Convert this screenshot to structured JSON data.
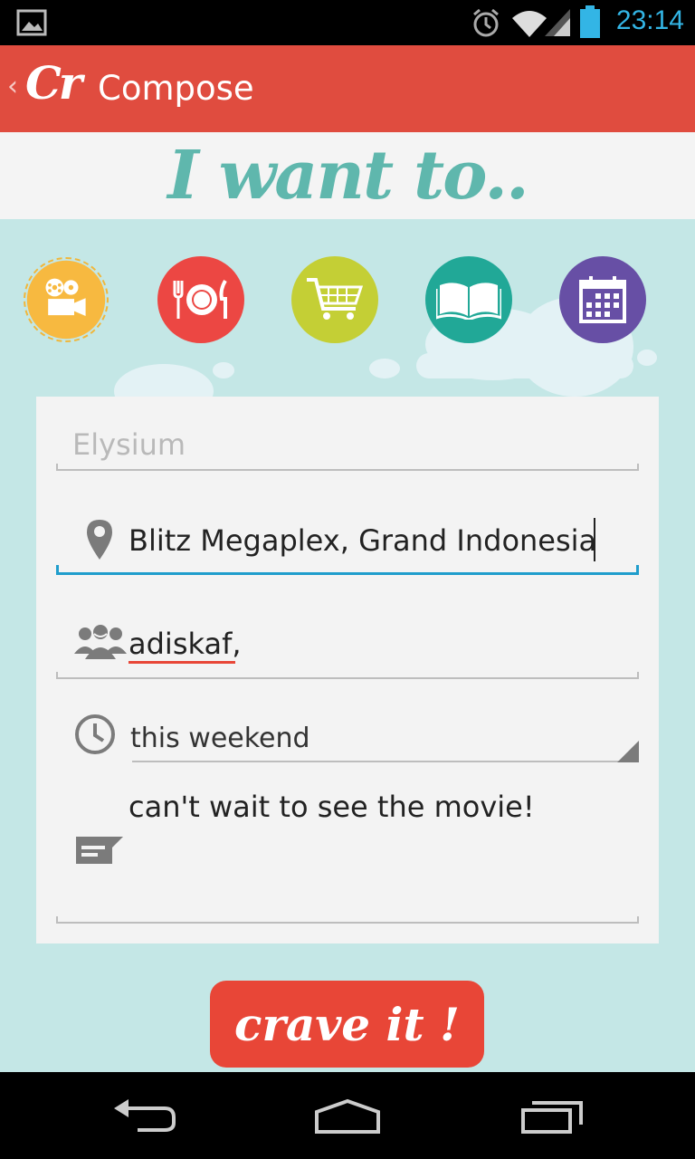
{
  "status_bar": {
    "time": "23:14"
  },
  "action_bar": {
    "logo": "Cr",
    "title": "Compose"
  },
  "header": {
    "title": "I want to.."
  },
  "categories": [
    {
      "name": "movie",
      "color": "#f7b940",
      "selected": true
    },
    {
      "name": "food",
      "color": "#ec4743"
    },
    {
      "name": "shopping",
      "color": "#c4cf35"
    },
    {
      "name": "reading",
      "color": "#21a897"
    },
    {
      "name": "event",
      "color": "#674fa5"
    }
  ],
  "form": {
    "title_placeholder": "Elysium",
    "location_value": "Blitz Megaplex, Grand Indonesia",
    "friends_value": "adiskaf,",
    "time_value": "this weekend",
    "message_value": "can't wait to see the movie!"
  },
  "submit": {
    "label": "crave it !"
  },
  "colors": {
    "accent": "#e04c3f",
    "focus_underline": "#1f9dcc",
    "background": "#c4e7e6"
  }
}
